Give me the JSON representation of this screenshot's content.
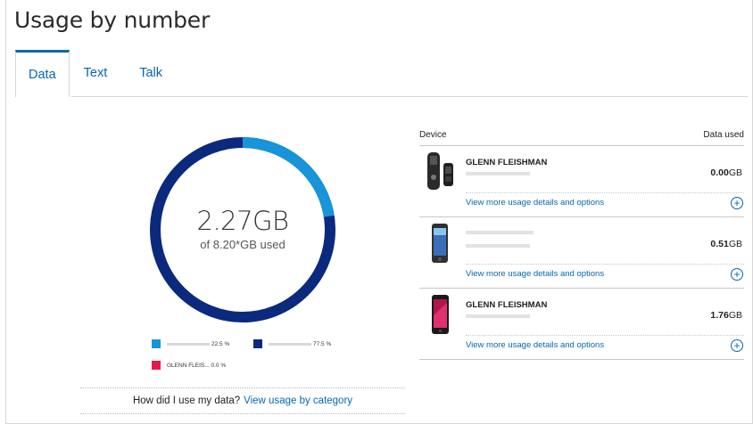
{
  "page_title": "Usage by number",
  "tabs": [
    {
      "label": "Data",
      "active": true
    },
    {
      "label": "Text",
      "active": false
    },
    {
      "label": "Talk",
      "active": false
    }
  ],
  "usage": {
    "used_value": "2.27GB",
    "plan_text": "of 8.20*GB used",
    "used_fraction": 0.225
  },
  "legend": [
    {
      "label": "22.5 %",
      "color": "#1795d8"
    },
    {
      "label": "77.5 %",
      "color": "#0b2a7e"
    },
    {
      "label": "GLENN FLEIS... 0.0 %",
      "color": "#e8194a"
    }
  ],
  "footer": {
    "question": "How did I use my data?",
    "link": "View usage by category"
  },
  "device_table": {
    "col_device": "Device",
    "col_data_used": "Data used",
    "rows": [
      {
        "name": "GLENN FLEISHMAN",
        "amount": "0.00",
        "unit": "GB",
        "details_link": "View more usage details and options"
      },
      {
        "name": "",
        "amount": "0.51",
        "unit": "GB",
        "details_link": "View more usage details and options"
      },
      {
        "name": "GLENN FLEISHMAN",
        "amount": "1.76",
        "unit": "GB",
        "details_link": "View more usage details and options"
      }
    ]
  },
  "colors": {
    "accent": "#0568ae",
    "donut_used": "#1795d8",
    "donut_remaining": "#0b2a7e"
  }
}
